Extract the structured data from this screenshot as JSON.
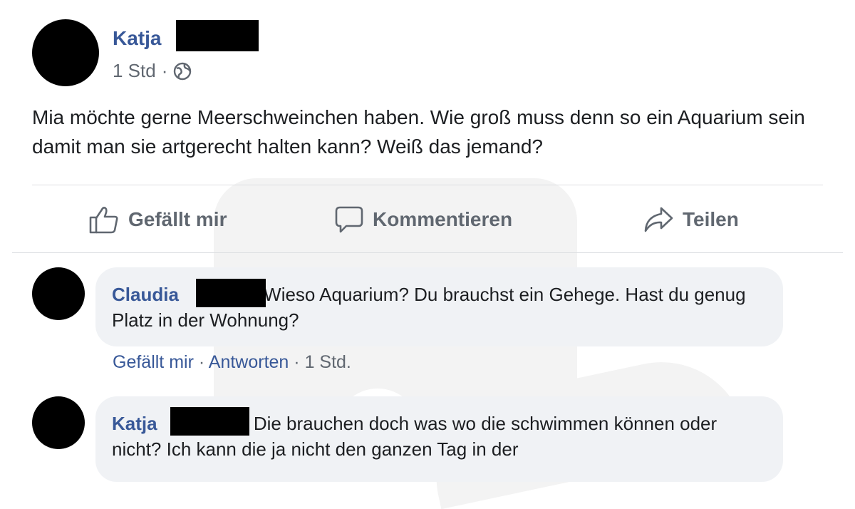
{
  "post": {
    "author": "Katja",
    "time": "1 Std",
    "separator": "·",
    "privacy_icon": "globe-icon",
    "text": "Mia möchte gerne Meerschweinchen haben. Wie groß muss denn so ein Aquarium sein damit man sie artgerecht halten kann? Weiß das jemand?"
  },
  "actions": {
    "like": "Gefällt mir",
    "comment": "Kommentieren",
    "share": "Teilen"
  },
  "comments": [
    {
      "author": "Claudia",
      "text": "Wieso Aquarium? Du brauchst ein Gehege. Hast du genug Platz in der Wohnung?",
      "like": "Gefällt mir",
      "reply": "Antworten",
      "time": "1 Std."
    },
    {
      "author": "Katja",
      "text": "Die brauchen doch was wo die schwimmen können oder nicht? Ich kann die ja nicht den ganzen Tag in der"
    }
  ],
  "colors": {
    "link": "#385898",
    "meta": "#606770",
    "bubble": "#f0f2f5"
  }
}
